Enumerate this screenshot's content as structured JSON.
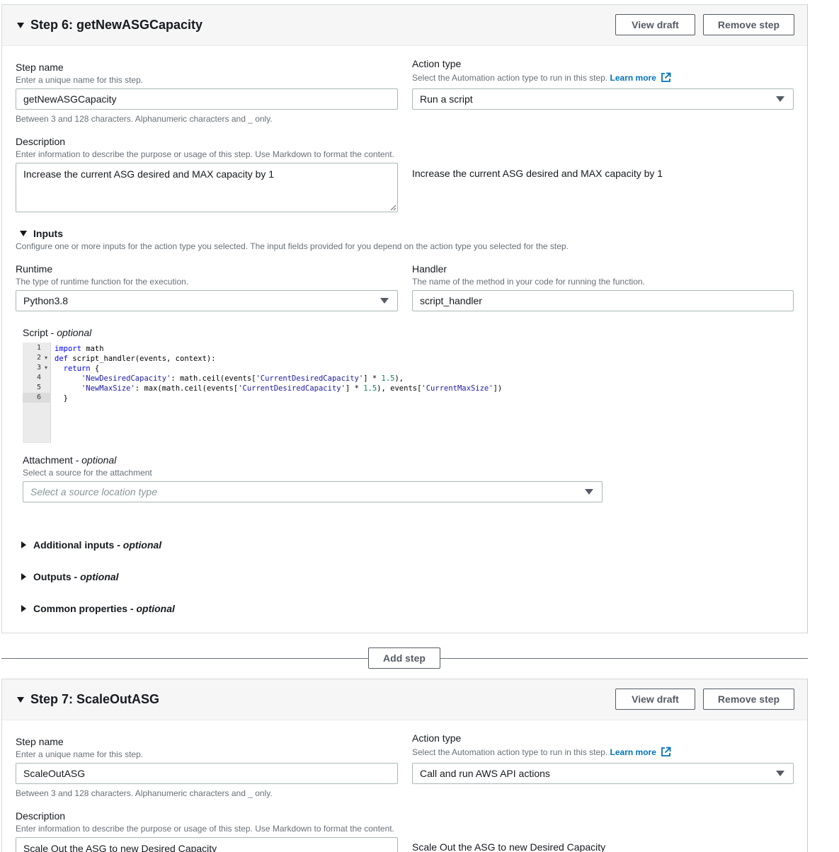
{
  "step6": {
    "title": "Step 6: getNewASGCapacity",
    "view_draft": "View draft",
    "remove_step": "Remove step",
    "step_name": {
      "label": "Step name",
      "description": "Enter a unique name for this step.",
      "value": "getNewASGCapacity",
      "constraint": "Between 3 and 128 characters. Alphanumeric characters and _ only."
    },
    "action_type": {
      "label": "Action type",
      "description": "Select the Automation action type to run in this step.",
      "learn_more": "Learn more",
      "value": "Run a script"
    },
    "description": {
      "label": "Description",
      "help": "Enter information to describe the purpose or usage of this step. Use Markdown to format the content.",
      "value": "Increase the current ASG desired and MAX capacity by 1",
      "preview": "Increase the current ASG desired and MAX capacity by 1"
    },
    "inputs": {
      "title": "Inputs",
      "description": "Configure one or more inputs for the action type you selected. The input fields provided for you depend on the action type you selected for the step.",
      "runtime_label": "Runtime",
      "runtime_desc": "The type of runtime function for the execution.",
      "runtime_value": "Python3.8",
      "handler_label": "Handler",
      "handler_desc": "The name of the method in your code for running the function.",
      "handler_value": "script_handler",
      "script_label": "Script - ",
      "script_optional": "optional",
      "script_lines": [
        "1",
        "2",
        "3",
        "4",
        "5",
        "6"
      ],
      "attachment_label": "Attachment - ",
      "attachment_optional": "optional",
      "attachment_desc": "Select a source for the attachment",
      "attachment_placeholder": "Select a source location type"
    },
    "additional_inputs": "Additional inputs - ",
    "outputs": "Outputs - ",
    "common_properties": "Common properties - ",
    "optional": "optional"
  },
  "add_step": "Add step",
  "step7": {
    "title": "Step 7: ScaleOutASG",
    "view_draft": "View draft",
    "remove_step": "Remove step",
    "step_name": {
      "label": "Step name",
      "description": "Enter a unique name for this step.",
      "value": "ScaleOutASG",
      "constraint": "Between 3 and 128 characters. Alphanumeric characters and _ only."
    },
    "action_type": {
      "label": "Action type",
      "description": "Select the Automation action type to run in this step.",
      "learn_more": "Learn more",
      "value": "Call and run AWS API actions"
    },
    "description": {
      "label": "Description",
      "help": "Enter information to describe the purpose or usage of this step. Use Markdown to format the content.",
      "value": "Scale Out the ASG to new Desired Capacity",
      "preview": "Scale Out the ASG to new Desired Capacity"
    }
  },
  "colors": {
    "link": "#0073bb",
    "header_bg": "#f6f6f6",
    "border": "#aab7b8",
    "button_text": "#545b64"
  }
}
